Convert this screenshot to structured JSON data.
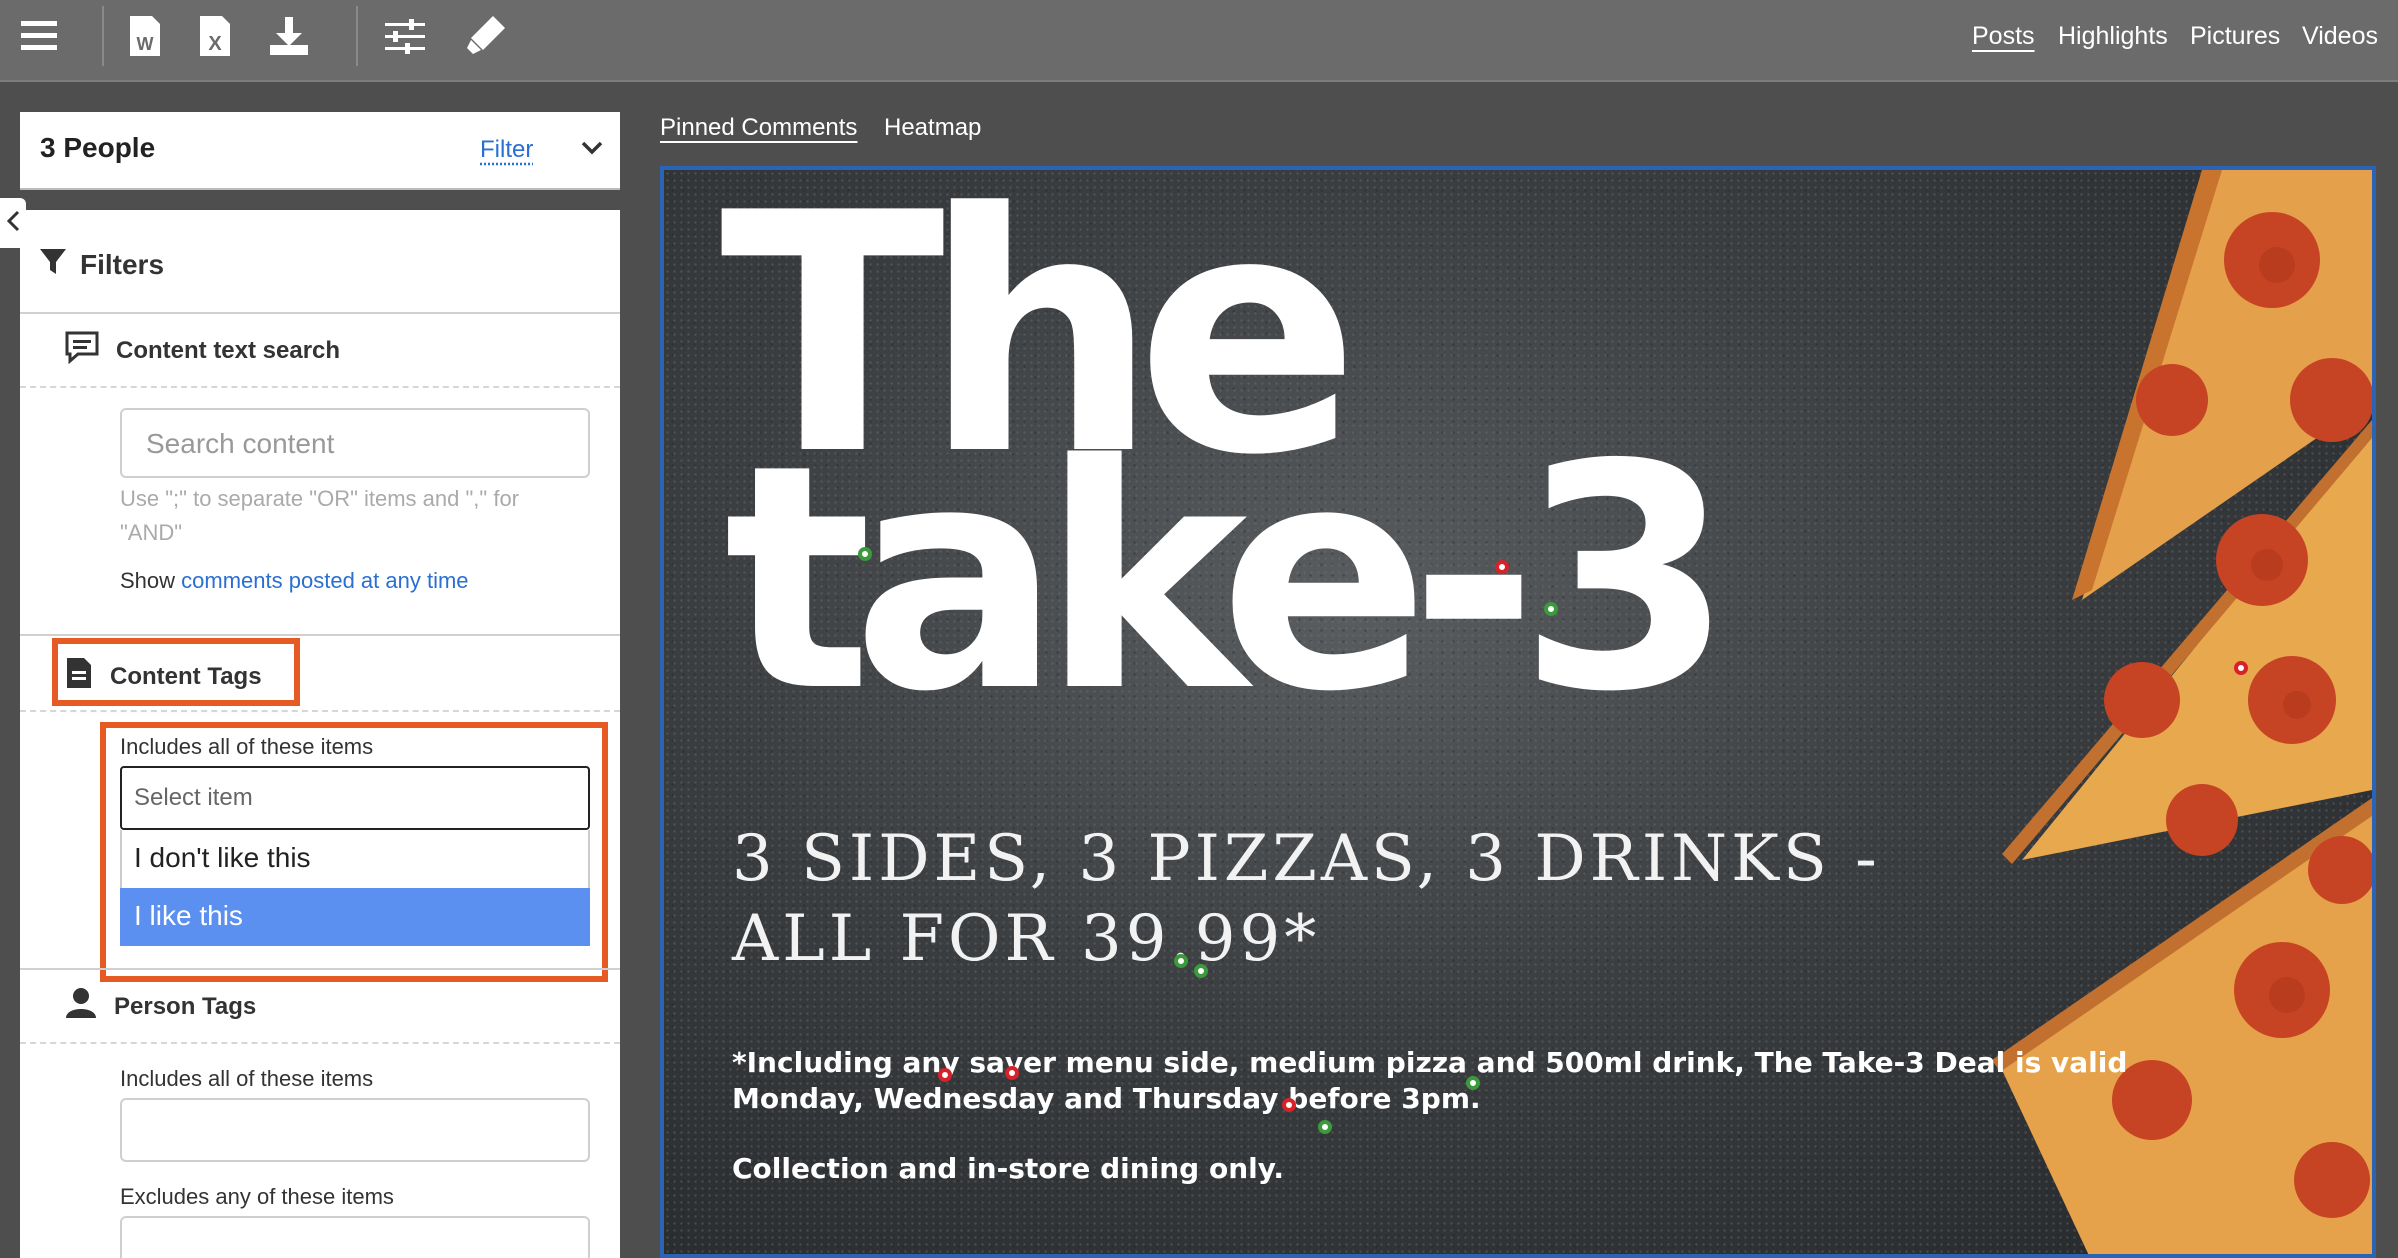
{
  "toolbar": {
    "icons": [
      "menu-icon",
      "word-export-icon",
      "excel-export-icon",
      "download-icon",
      "settings-sliders-icon",
      "highlighter-icon"
    ],
    "nav": [
      "Posts",
      "Highlights",
      "Pictures",
      "Videos"
    ],
    "active_nav": "Posts"
  },
  "sidebar": {
    "people_title": "3 People",
    "filter_link": "Filter",
    "filters_heading": "Filters",
    "content_text_search": {
      "heading": "Content text search",
      "placeholder": "Search content",
      "hint": "Use \";\" to separate \"OR\" items and \",\" for \"AND\"",
      "show_prefix": "Show",
      "show_link": "comments posted at any time"
    },
    "content_tags": {
      "heading": "Content Tags",
      "includes_label": "Includes all of these items",
      "select_placeholder": "Select item",
      "options": [
        "I don't like this",
        "I like this"
      ],
      "selected_option": "I like this"
    },
    "person_tags": {
      "heading": "Person Tags",
      "includes_label": "Includes all of these items",
      "excludes_label": "Excludes any of these items"
    }
  },
  "main": {
    "tabs": [
      "Pinned Comments",
      "Heatmap"
    ],
    "active_tab": "Pinned Comments",
    "poster": {
      "title_line1": "The",
      "title_line2": "take-3",
      "subtitle_line1": "3 SIDES, 3 PIZZAS, 3 DRINKS -",
      "subtitle_line2": "ALL FOR 39.99*",
      "small_line1": "*Including any saver menu side, medium pizza and 500ml drink, The Take-3 Deal is valid",
      "small_line2": "Monday, Wednesday and Thursday before 3pm.",
      "small_line3": "Collection and in-store dining only."
    },
    "pin_colors": {
      "like": "#3b9a3b",
      "dislike": "#d8222a"
    }
  },
  "colors": {
    "accent": "#2a6fd1",
    "highlight_box": "#e65a24",
    "selected_option": "#5b8ff0",
    "toolbar": "#6b6b6b"
  }
}
